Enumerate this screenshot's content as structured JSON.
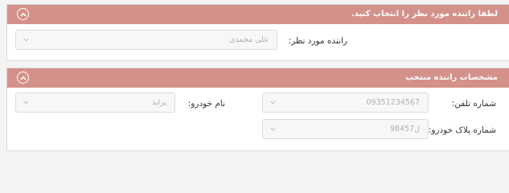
{
  "driver_panel": {
    "title": "لطفا راننده مورد نظر را انتخاب کنید.",
    "driver_label": "راننده مورد نظر:",
    "driver_value": "علی محمدی"
  },
  "details_panel": {
    "title": "مشخصات راننده منتخب",
    "phone_label": "شماره تلفن:",
    "phone_value": "09351234567",
    "car_label": "نام خودرو:",
    "car_value": "پراید",
    "plate_label": "شماره پلاک خودرو:",
    "plate_value": "98ل457"
  },
  "icons": {
    "collapse": "chevron-up-icon",
    "dropdown": "chevron-down-icon"
  },
  "colors": {
    "header_bg": "#d4918a",
    "header_text": "#ffffff",
    "field_bg": "#f7f7f7",
    "placeholder_text": "#b0b0b0"
  }
}
